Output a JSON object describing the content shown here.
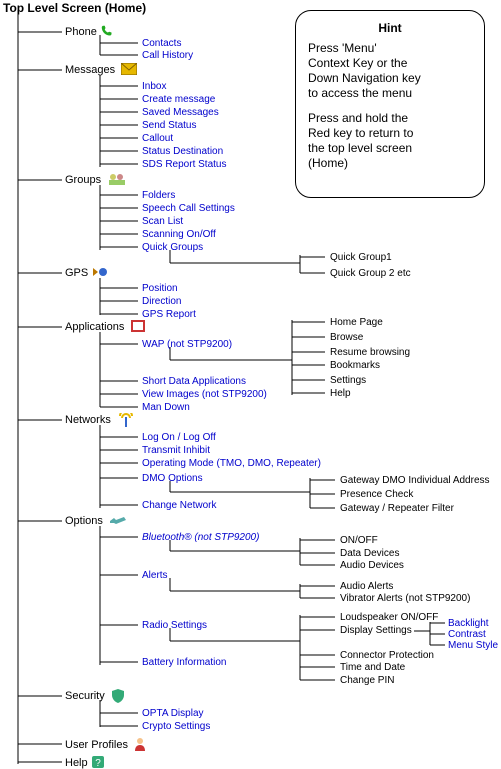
{
  "title": "Top Level Screen   (Home)",
  "hint": {
    "title": "Hint",
    "p1_l1": "Press 'Menu'",
    "p1_l2": "Context Key or the",
    "p1_l3": "Down Navigation key",
    "p1_l4": "to access the menu",
    "p2_l1": "Press and hold the",
    "p2_l2": "Red key to return to",
    "p2_l3": "the top level screen",
    "p2_l4": " (Home)"
  },
  "sections": {
    "phone": "Phone",
    "messages": "Messages",
    "groups": "Groups",
    "gps": "GPS",
    "applications": "Applications",
    "networks": "Networks",
    "options": "Options",
    "security": "Security",
    "user_profiles": "User Profiles",
    "help": "Help"
  },
  "phone": {
    "contacts": "Contacts",
    "call_history": "Call History"
  },
  "messages": {
    "inbox": "Inbox",
    "create": "Create message",
    "saved": "Saved Messages",
    "send_status": "Send Status",
    "callout": "Callout",
    "status_dest": "Status Destination",
    "sds_report": "SDS Report Status"
  },
  "groups": {
    "folders": "Folders",
    "speech": "Speech Call Settings",
    "scan_list": "Scan List",
    "scanning": "Scanning On/Off",
    "quick_groups": "Quick Groups"
  },
  "quick_group_leaves": {
    "qg1": "Quick Group1",
    "qg2": "Quick Group 2 etc"
  },
  "gps": {
    "position": "Position",
    "direction": "Direction",
    "report": "GPS Report"
  },
  "apps": {
    "wap": "WAP (not STP9200)",
    "short_data": "Short Data Applications",
    "view_images": "View Images (not STP9200)",
    "man_down": "Man Down"
  },
  "wap_leaves": {
    "home": "Home Page",
    "browse": "Browse",
    "resume": "Resume browsing",
    "bookmarks": "Bookmarks",
    "settings": "Settings",
    "help": "Help"
  },
  "networks": {
    "logon": "Log On / Log Off",
    "transmit": "Transmit Inhibit",
    "opmode": "Operating Mode (TMO, DMO, Repeater)",
    "dmo": "DMO Options",
    "change": "Change Network"
  },
  "dmo_leaves": {
    "gateway_addr": "Gateway DMO Individual Address",
    "presence": "Presence Check",
    "filter": "Gateway / Repeater Filter"
  },
  "options": {
    "bluetooth": "Bluetooth® (not STP9200)",
    "alerts": "Alerts",
    "radio": "Radio Settings",
    "battery": "Battery Information"
  },
  "bt_leaves": {
    "onoff": "ON/OFF",
    "data": "Data Devices",
    "audio": "Audio Devices"
  },
  "alert_leaves": {
    "audio_alerts": "Audio Alerts",
    "vibrator": "Vibrator Alerts (not STP9200)"
  },
  "radio_leaves": {
    "loudspeaker": "Loudspeaker ON/OFF",
    "display": "Display Settings",
    "connector": "Connector Protection",
    "time": "Time and Date",
    "pin": "Change PIN"
  },
  "display_leaves": {
    "backlight": "Backlight",
    "contrast": "Contrast",
    "menu_style": "Menu Style"
  },
  "security": {
    "opta": "OPTA Display",
    "crypto": "Crypto Settings"
  }
}
